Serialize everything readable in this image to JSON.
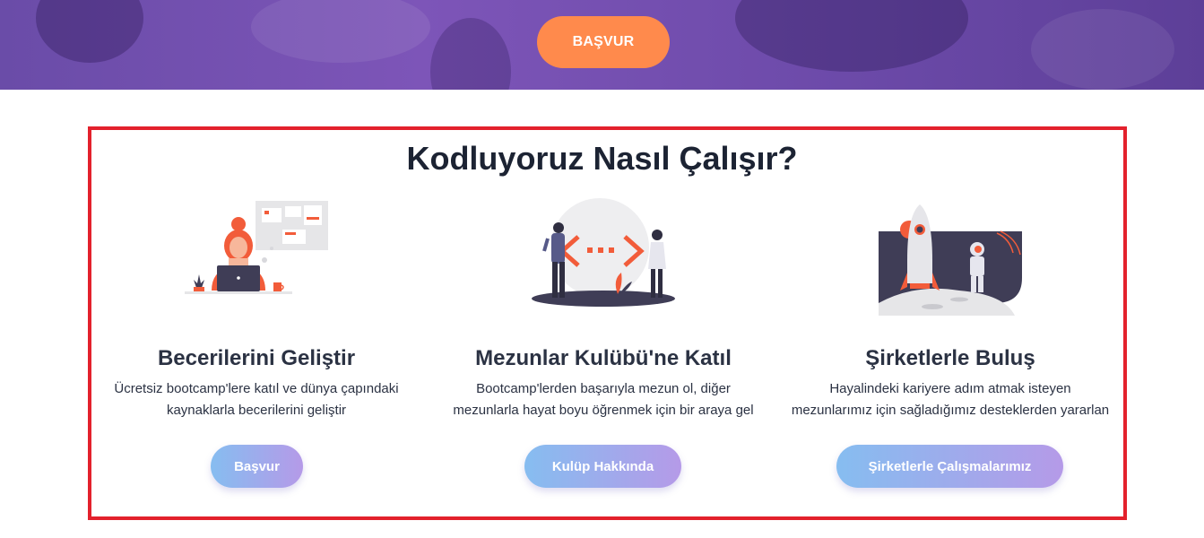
{
  "hero": {
    "apply_label": "BAŞVUR"
  },
  "section": {
    "title": "Kodluyoruz Nasıl Çalışır?"
  },
  "cards": [
    {
      "illustration": "developer-at-laptop-illustration",
      "title": "Becerilerini Geliştir",
      "desc_line1": "Ücretsiz bootcamp'lere katıl ve dünya çapındaki",
      "desc_line2": "kaynaklarla becerilerini geliştir",
      "button": "Başvur"
    },
    {
      "illustration": "people-connecting-code-illustration",
      "title": "Mezunlar Kulübü'ne Katıl",
      "desc_line1": "Bootcamp'lerden başarıyla mezun ol, diğer",
      "desc_line2": "mezunlarla hayat boyu öğrenmek için bir araya gel",
      "button": "Kulüp Hakkında"
    },
    {
      "illustration": "rocket-astronaut-illustration",
      "title": "Şirketlerle Buluş",
      "desc_line1": "Hayalindeki kariyere adım atmak isteyen",
      "desc_line2": "mezunlarımız için sağladığımız desteklerden yararlan",
      "button": "Şirketlerle Çalışmalarımız"
    }
  ],
  "colors": {
    "hero_purple": "#6c4aa9",
    "orange_button": "#ff8a4c",
    "highlight_red": "#e3212c",
    "title_text": "#1c2333",
    "gradient_start": "#86bdf0",
    "gradient_end": "#b59ae8"
  }
}
